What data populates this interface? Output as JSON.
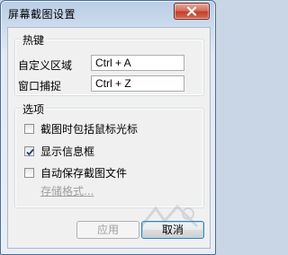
{
  "window": {
    "title": "屏幕截图设置"
  },
  "hotkeys": {
    "group_label": "热键",
    "custom_area_label": "自定义区域",
    "custom_area_value": "Ctrl + A",
    "window_capture_label": "窗口捕捉",
    "window_capture_value": "Ctrl + Z"
  },
  "options": {
    "group_label": "选项",
    "include_cursor": {
      "label": "截图时包括鼠标光标",
      "checked": false
    },
    "show_info_box": {
      "label": "显示信息框",
      "checked": true
    },
    "auto_save": {
      "label": "自动保存截图文件",
      "checked": false
    },
    "storage_format_link": "存储格式..."
  },
  "buttons": {
    "apply_label": "应用",
    "cancel_label": "取消"
  },
  "colors": {
    "close_button": "#c0402a",
    "default_button_border": "#3c7fb1"
  }
}
